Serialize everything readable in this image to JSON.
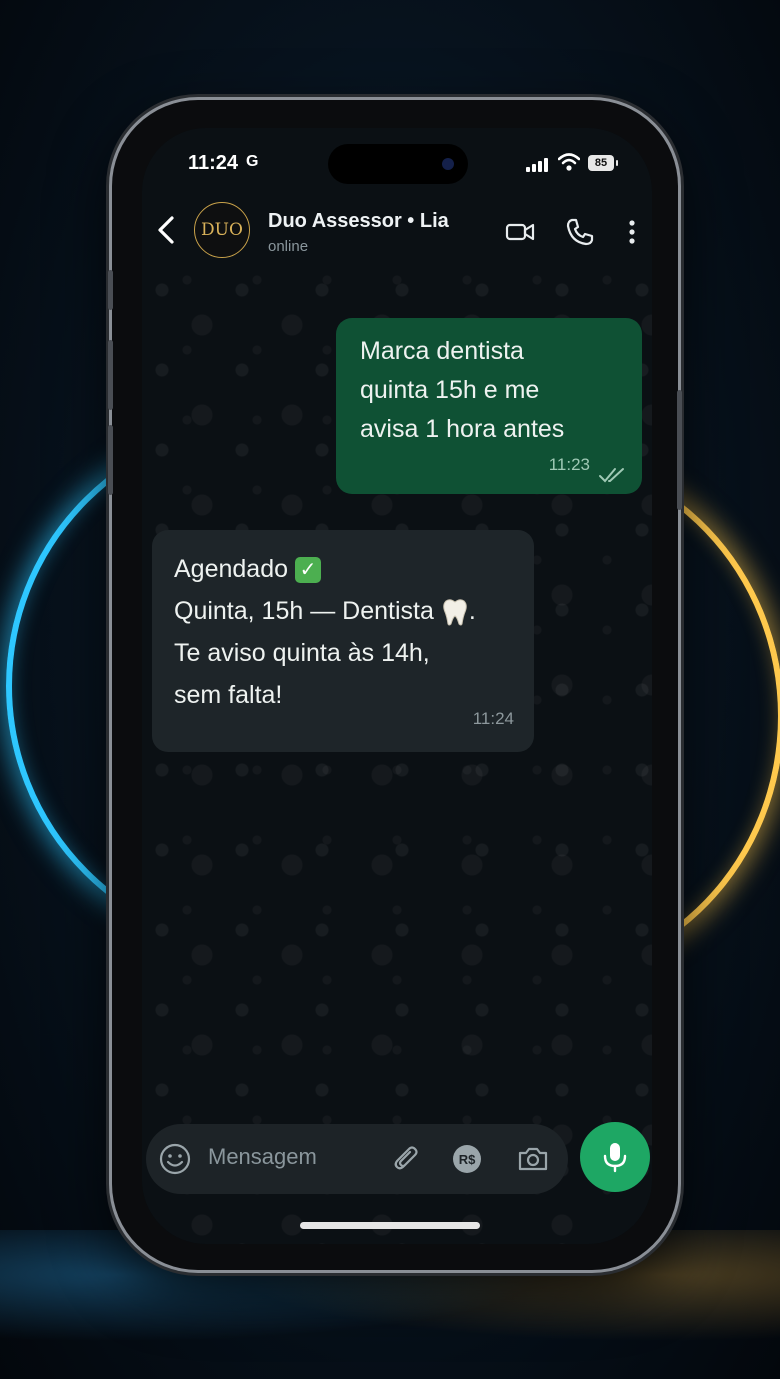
{
  "status_bar": {
    "time": "11:24",
    "g_label": "G",
    "battery": "85"
  },
  "header": {
    "avatar_text": "DUO",
    "contact_name": "Duo Assessor • Lia",
    "contact_status": "online",
    "icons": [
      "back-chevron-icon",
      "video-call-icon",
      "phone-call-icon",
      "more-options-icon"
    ]
  },
  "messages": [
    {
      "direction": "outgoing",
      "lines": [
        "Marca dentista",
        "quinta 15h e me",
        "avisa 1 hora antes"
      ],
      "time": "11:23",
      "read_ticks": "✓✓"
    },
    {
      "direction": "incoming",
      "lines": [
        "Agendado",
        "Quinta, 15h — Dentista",
        "Te aviso quinta às 14h,",
        "sem falta!"
      ],
      "line_suffixes": {
        "0": "check-emoji",
        "1": "tooth-emoji",
        "1_after": "."
      },
      "emoji_check": "✓",
      "period": ".",
      "time": "11:24"
    }
  ],
  "composer": {
    "placeholder": "Mensagem",
    "pix_label": "R$",
    "icons": [
      "emoji-icon",
      "attach-icon",
      "payment-icon",
      "camera-icon",
      "microphone-icon"
    ]
  },
  "colors": {
    "outgoing_bubble": "#0f5134",
    "incoming_bubble": "#1e2529",
    "accent_green": "#1ea764",
    "avatar_gold": "#c9a24a",
    "ring_blue": "#2ec7ff",
    "ring_gold": "#ffc94d"
  }
}
